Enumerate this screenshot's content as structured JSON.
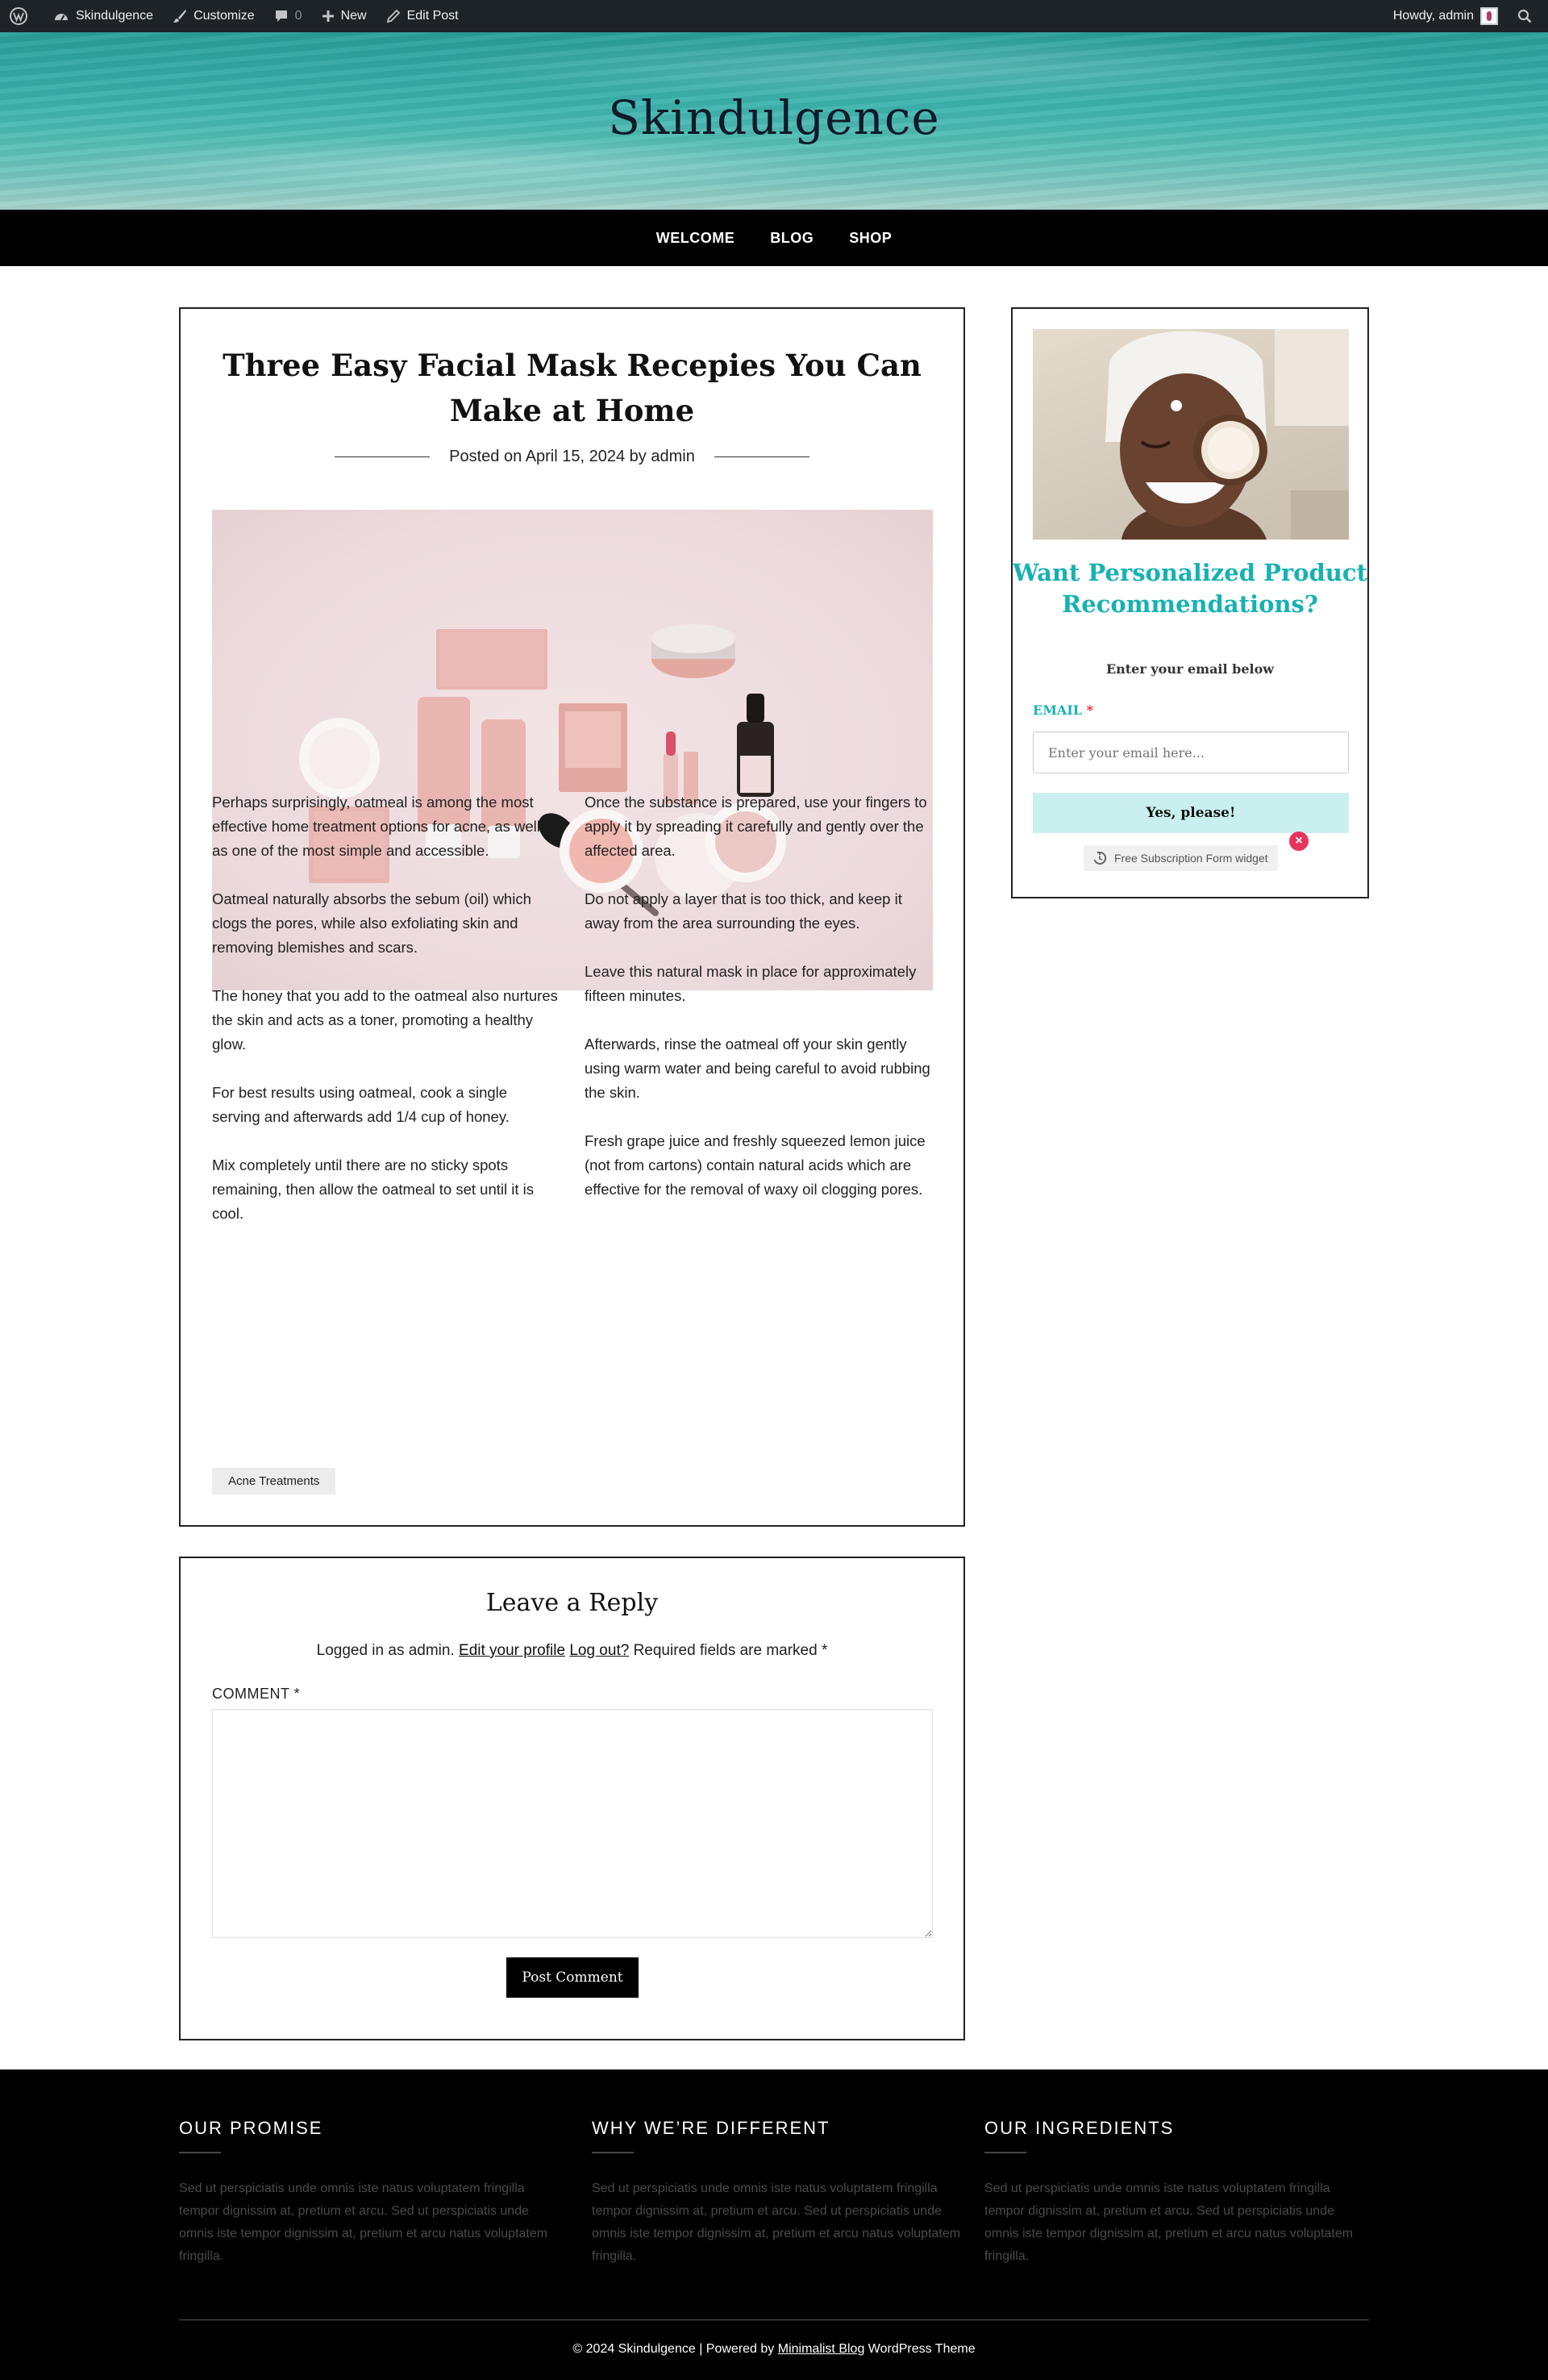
{
  "adminbar": {
    "site": "Skindulgence",
    "customize": "Customize",
    "comments_count": "0",
    "new": "New",
    "edit_post": "Edit Post",
    "howdy": "Howdy, admin"
  },
  "header": {
    "site_title": "Skindulgence"
  },
  "nav": {
    "items": [
      "WELCOME",
      "BLOG",
      "SHOP"
    ]
  },
  "post": {
    "title": "Three Easy Facial Mask Recepies You Can Make at Home",
    "meta_prefix": "Posted on",
    "date": "April 15, 2024",
    "meta_by": "by",
    "author": "admin",
    "left_paragraphs": [
      "Perhaps surprisingly, oatmeal is among the most effective home treatment options for acne, as well as one of the most simple and accessible.",
      "Oatmeal naturally absorbs the sebum (oil) which clogs the pores, while also exfoliating skin and removing blemishes and scars.",
      "The honey that you add to the oatmeal also nurtures the skin and acts as a toner, promoting a healthy glow.",
      "For best results using oatmeal, cook a single serving and afterwards add 1/4 cup of honey.",
      "Mix completely until there are no sticky spots remaining, then allow the oatmeal to set until it is cool."
    ],
    "right_paragraphs": [
      "Once the substance is prepared, use your fingers to apply it by spreading it carefully and gently over the affected area.",
      "Do not apply a layer that is too thick, and keep it away from the area surrounding the eyes.",
      "Leave this natural mask in place for approximately fifteen minutes.",
      "Afterwards, rinse the oatmeal off your skin gently using warm water and being careful to avoid rubbing the skin.",
      "Fresh grape juice and freshly squeezed lemon juice (not from cartons) contain natural acids which are effective for the removal of waxy oil clogging pores."
    ],
    "tag": "Acne Treatments"
  },
  "reply": {
    "heading": "Leave a Reply",
    "logged_prefix": "Logged in as admin.",
    "edit_profile": "Edit your profile",
    "logout": "Log out?",
    "required": "Required fields are marked *",
    "comment_label": "COMMENT *",
    "submit": "Post Comment"
  },
  "widget": {
    "headline": "Want Personalized Product Recommendations?",
    "sub": "Enter your email below",
    "email_label": "EMAIL",
    "required_mark": "*",
    "placeholder": "Enter your email here...",
    "button": "Yes, please!",
    "badge": "Free Subscription Form widget",
    "close": "×"
  },
  "footer": {
    "columns": [
      {
        "title": "OUR PROMISE",
        "text": "Sed ut perspiciatis unde omnis iste natus voluptatem fringilla tempor dignissim at, pretium et arcu. Sed ut perspiciatis unde omnis iste tempor dignissim at, pretium et arcu natus voluptatem fringilla."
      },
      {
        "title": "WHY WE’RE DIFFERENT",
        "text": "Sed ut perspiciatis unde omnis iste natus voluptatem fringilla tempor dignissim at, pretium et arcu. Sed ut perspiciatis unde omnis iste tempor dignissim at, pretium et arcu natus voluptatem fringilla."
      },
      {
        "title": "OUR INGREDIENTS",
        "text": "Sed ut perspiciatis unde omnis iste natus voluptatem fringilla tempor dignissim at, pretium et arcu. Sed ut perspiciatis unde omnis iste tempor dignissim at, pretium et arcu natus voluptatem fringilla."
      }
    ],
    "copy_prefix": "© 2024 Skindulgence | Powered by",
    "theme_link": "Minimalist Blog",
    "copy_suffix": "WordPress Theme"
  }
}
